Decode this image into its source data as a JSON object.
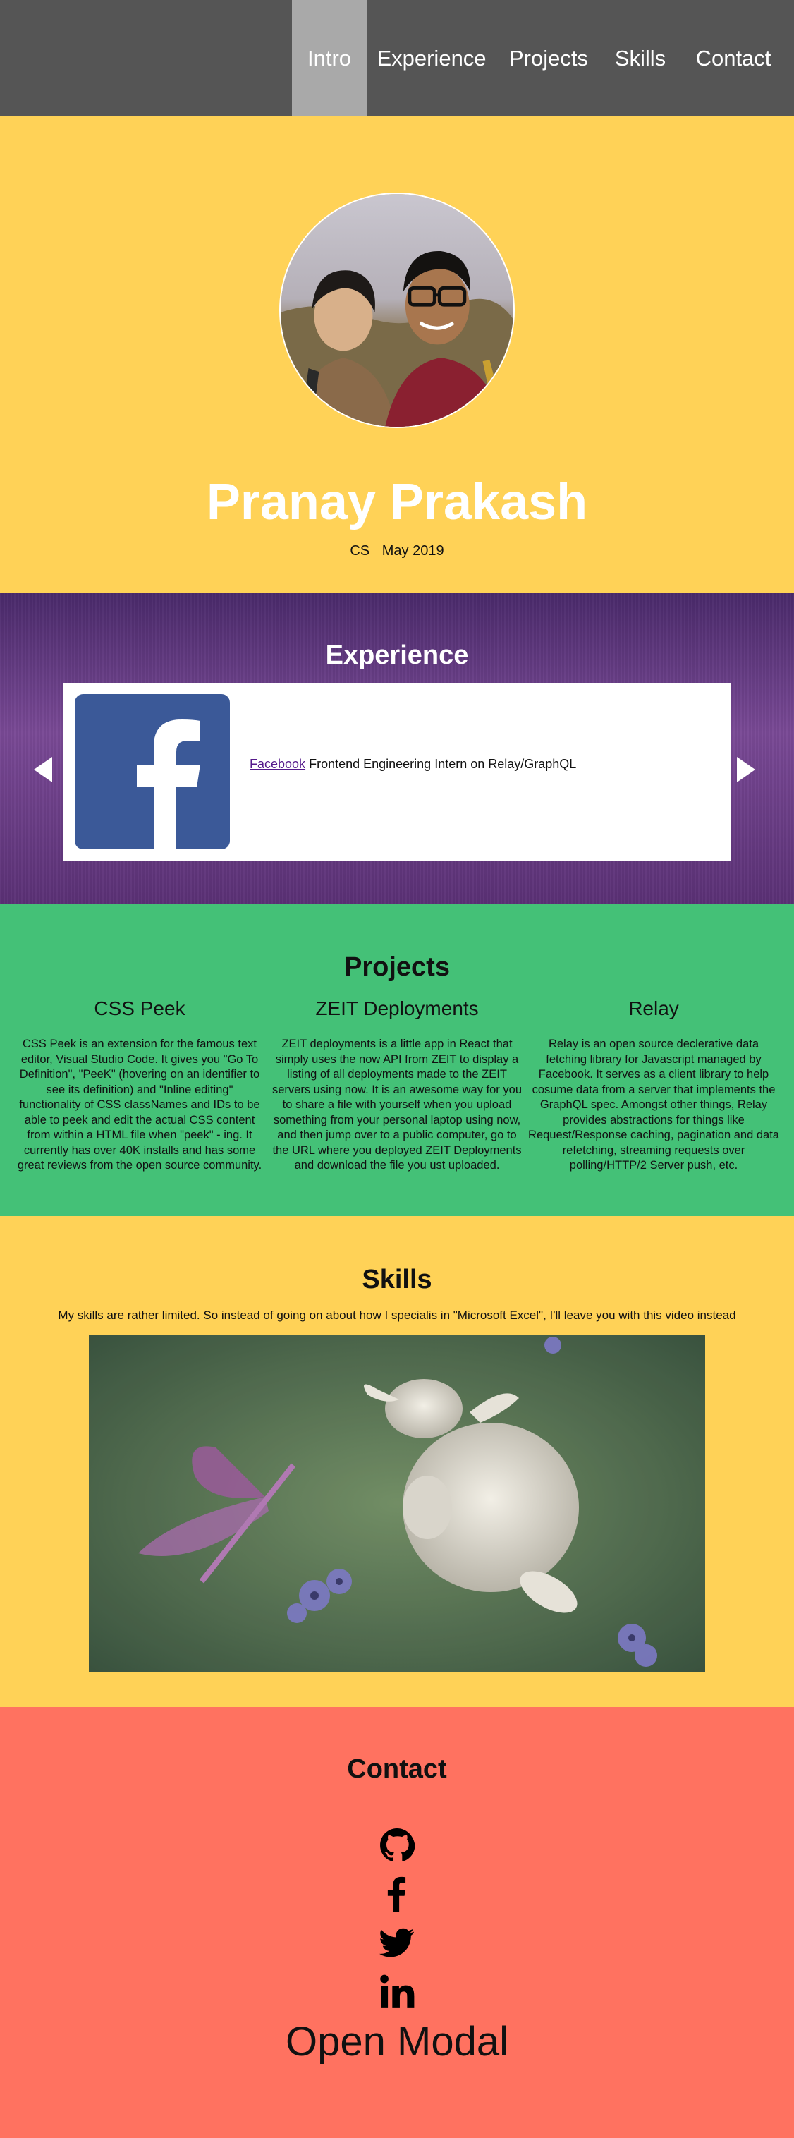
{
  "nav": {
    "items": [
      {
        "label": "Intro",
        "active": true
      },
      {
        "label": "Experience"
      },
      {
        "label": "Projects"
      },
      {
        "label": "Skills"
      },
      {
        "label": "Contact"
      }
    ]
  },
  "intro": {
    "name": "Pranay Prakash",
    "major": "CS",
    "graduation": "May 2019"
  },
  "experience": {
    "title": "Experience",
    "items": [
      {
        "company": "Facebook",
        "role": "Frontend Engineering Intern on Relay/GraphQL",
        "logo": "facebook-logo"
      }
    ]
  },
  "projects": {
    "title": "Projects",
    "items": [
      {
        "name": "CSS Peek",
        "description": "CSS Peek is an extension for the famous text editor, Visual Studio Code. It gives you \"Go To Definition\", \"PeeK\" (hovering on an identifier to see its definition) and \"Inline editing\" functionality of CSS classNames and IDs to be able to peek and edit the actual CSS content from within a HTML file when \"peek\" - ing. It currently has over 40K installs and has some great reviews from the open source community."
      },
      {
        "name": "ZEIT Deployments",
        "description": "ZEIT deployments is a little app in React that simply uses the now API from ZEIT to display a listing of all deployments made to the ZEIT servers using now. It is an awesome way for you to share a file with yourself when you upload something from your personal laptop using now, and then jump over to a public computer, go to the URL where you deployed ZEIT Deployments and download the file you ust uploaded."
      },
      {
        "name": "Relay",
        "description": "Relay is an open source declerative data fetching library for Javascript managed by Facebook. It serves as a client library to help cosume data from a server that implements the GraphQL spec. Amongst other things, Relay provides abstractions for things like Request/Response caching, pagination and data refetching, streaming requests over polling/HTTP/2 Server push, etc."
      }
    ]
  },
  "skills": {
    "title": "Skills",
    "text": "My skills are rather limited. So instead of going on about how I specialis in \"Microsoft Excel\", I'll leave you with this video instead"
  },
  "contact": {
    "title": "Contact",
    "links": [
      {
        "icon": "github-icon"
      },
      {
        "icon": "facebook-icon"
      },
      {
        "icon": "twitter-icon"
      },
      {
        "icon": "linkedin-icon"
      }
    ],
    "open_modal": "Open Modal"
  },
  "colors": {
    "nav_bg": "#555555",
    "nav_active": "#a9a9a9",
    "yellow": "#ffd257",
    "green": "#44c177",
    "coral": "#ff7260",
    "purple": "#5b3176",
    "facebook_blue": "#3b5998"
  }
}
